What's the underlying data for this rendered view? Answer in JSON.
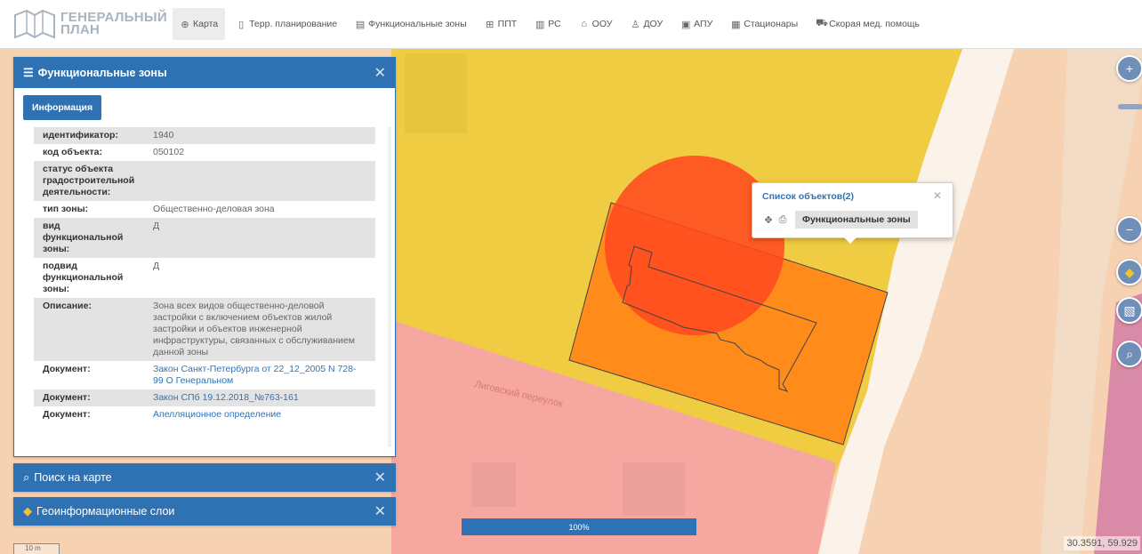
{
  "app": {
    "logo_text_line1": "ГЕНЕРАЛЬНЫЙ",
    "logo_text_line2": "ПЛАН"
  },
  "nav": [
    {
      "label": "Карта",
      "icon": "globe-icon",
      "active": true
    },
    {
      "label": "Терр. планирование",
      "icon": "document-icon"
    },
    {
      "label": "Функциональные зоны",
      "icon": "layout-icon"
    },
    {
      "label": "ППТ",
      "icon": "grid-icon"
    },
    {
      "label": "РС",
      "icon": "book-icon"
    },
    {
      "label": "ООУ",
      "icon": "school-icon"
    },
    {
      "label": "ДОУ",
      "icon": "kindergarten-icon"
    },
    {
      "label": "АПУ",
      "icon": "image-icon"
    },
    {
      "label": "Стационары",
      "icon": "hospital-icon"
    },
    {
      "label": "Скорая мед. помощь",
      "icon": "ambulance-icon"
    }
  ],
  "panel_fz": {
    "title": "Функциональные зоны",
    "tab": "Информация",
    "rows": [
      {
        "key": "идентификатор:",
        "value": "1940"
      },
      {
        "key": "код объекта:",
        "value": "050102"
      },
      {
        "key": "статус объекта градостроительной деятельности:",
        "value": ""
      },
      {
        "key": "тип зоны:",
        "value": "Общественно-деловая зона"
      },
      {
        "key": "вид функциональной зоны:",
        "value": "Д"
      },
      {
        "key": "подвид функциональной зоны:",
        "value": "Д"
      },
      {
        "key": "Описание:",
        "value": "Зона всех видов общественно-деловой застройки с включением объектов жилой застройки и объектов инженерной инфраструктуры, связанных с обслуживанием данной зоны"
      },
      {
        "key": "Документ:",
        "value": "Закон Санкт-Петербурга от 22_12_2005 N 728-99 О Генеральном",
        "link": true
      },
      {
        "key": "Документ:",
        "value": "Закон СПб 19.12.2018_№763-161",
        "link": true
      },
      {
        "key": "Документ:",
        "value": "Апелляционное определение",
        "link": true
      }
    ]
  },
  "panel_search": {
    "title": "Поиск на карте"
  },
  "panel_geo": {
    "title": "Геоинформационные слои"
  },
  "popup": {
    "title": "Список объектов(2)",
    "item": "Функциональные зоны"
  },
  "map": {
    "street_label": "Лиговский переулок",
    "colors": {
      "yellow_zone": "#f0cc42",
      "orange_zone": "#ff8c1a",
      "red_circle": "#ff4a1f",
      "pink_zone": "#f5a7a0",
      "beige_zone": "#f6d2b2"
    }
  },
  "progress": {
    "label": "100%",
    "value": 1.0
  },
  "coords": "30.3591, 59.929",
  "scale": "10 m"
}
